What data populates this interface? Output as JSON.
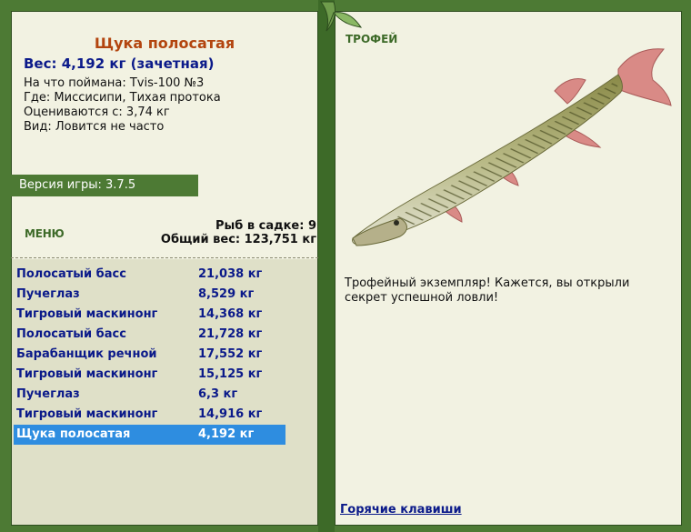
{
  "fish": {
    "title": "Щука полосатая",
    "weight_line": "Вес: 4,192 кг (зачетная)",
    "bait": "На что поймана: Tvis-100 №3",
    "location": "Где: Миссисипи, Тихая протока",
    "valued_from": "Оцениваются с: 3,74 кг",
    "rarity": "Вид: Ловится не часто"
  },
  "version": "Версия игры: 3.7.5",
  "menu_label": "МЕНЮ",
  "keepnet": {
    "count_text": "Рыб в садке: 9",
    "total_text": "Общий вес: 123,751 кг"
  },
  "catch_list": [
    {
      "name": "Полосатый басс",
      "weight": "21,038 кг"
    },
    {
      "name": "Пучеглаз",
      "weight": "8,529 кг"
    },
    {
      "name": "Тигровый маскинонг",
      "weight": "14,368 кг"
    },
    {
      "name": "Полосатый басс",
      "weight": "21,728 кг"
    },
    {
      "name": "Барабанщик речной",
      "weight": "17,552 кг"
    },
    {
      "name": "Тигровый маскинонг",
      "weight": "15,125 кг"
    },
    {
      "name": "Пучеглаз",
      "weight": "6,3 кг"
    },
    {
      "name": "Тигровый маскинонг",
      "weight": "14,916 кг"
    },
    {
      "name": "Щука полосатая",
      "weight": "4,192 кг",
      "selected": true
    }
  ],
  "trophy_label": "ТРОФЕЙ",
  "trophy_text": "Трофейный экземпляр! Кажется, вы открыли секрет успешной ловли!",
  "hotkeys": "Горячие клавиши",
  "colors": {
    "frame_green": "#4d7a34",
    "panel_bg": "#f2f2e2",
    "title_orange": "#b3450f",
    "link_blue": "#0b1a8a",
    "selected_row": "#2e8de0"
  }
}
